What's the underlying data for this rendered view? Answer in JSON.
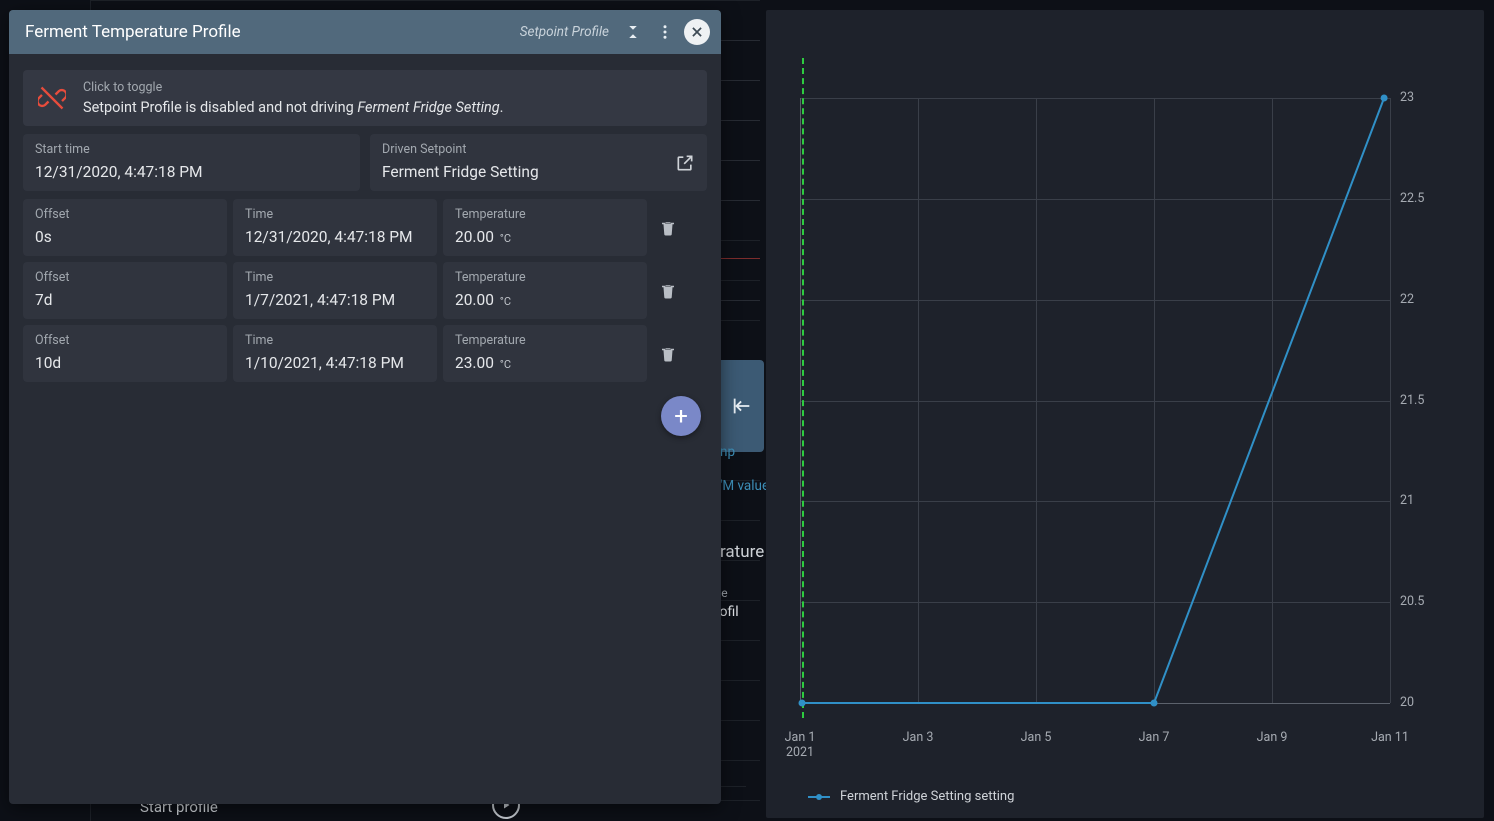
{
  "dialog": {
    "title": "Ferment Temperature Profile",
    "subtitle": "Setpoint Profile",
    "toggle": {
      "hint": "Click to toggle",
      "text_before": "Setpoint Profile is disabled and not driving ",
      "text_em": "Ferment Fridge Setting",
      "text_after": "."
    },
    "start_time": {
      "label": "Start time",
      "value": "12/31/2020, 4:47:18 PM"
    },
    "driven_setpoint": {
      "label": "Driven Setpoint",
      "value": "Ferment Fridge Setting"
    },
    "labels": {
      "offset": "Offset",
      "time": "Time",
      "temperature": "Temperature",
      "unit": "°C"
    },
    "rows": [
      {
        "offset": "0s",
        "time": "12/31/2020, 4:47:18 PM",
        "temp": "20.00"
      },
      {
        "offset": "7d",
        "time": "1/7/2021, 4:47:18 PM",
        "temp": "20.00"
      },
      {
        "offset": "10d",
        "time": "1/10/2021, 4:47:18 PM",
        "temp": "23.00"
      }
    ]
  },
  "background": {
    "pwm_label": "'M value",
    "title2_fragment": "rature",
    "toggle2_hint": "oggle",
    "toggle2_text": "t Profil",
    "start_profile": "Start profile",
    "num_at_bottom": "21.5",
    "np_placeholder": "np"
  },
  "legend": {
    "label": "Ferment Fridge Setting setting"
  },
  "chart_data": {
    "type": "line",
    "title": "",
    "xlabel": "",
    "ylabel": "",
    "x_ticks": [
      "Jan 1 2021",
      "Jan 3",
      "Jan 5",
      "Jan 7",
      "Jan 9",
      "Jan 11"
    ],
    "y_ticks": [
      20,
      20.5,
      21,
      21.5,
      22,
      22.5,
      23
    ],
    "ylim": [
      20,
      23
    ],
    "now_marker_x": "Jan 1 2021",
    "series": [
      {
        "name": "Ferment Fridge Setting setting",
        "x": [
          "Dec 31 2020",
          "Jan 7 2021",
          "Jan 10 2021"
        ],
        "y": [
          20,
          20,
          23
        ]
      }
    ]
  }
}
